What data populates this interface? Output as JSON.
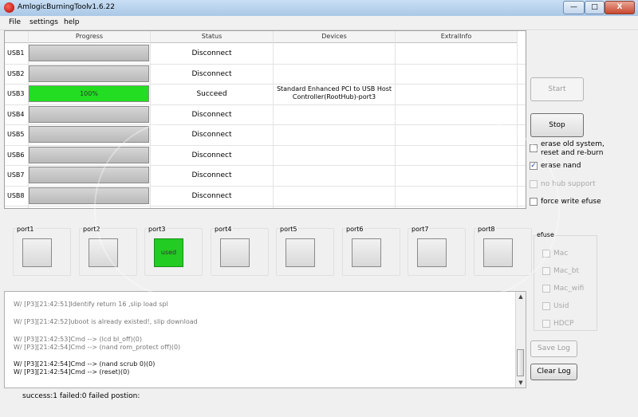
{
  "window": {
    "title": "AmlogicBurningTool",
    "version": "v1.6.22",
    "buttons": {
      "minimize": "—",
      "maximize": "□",
      "close": "X"
    }
  },
  "menu": [
    "File",
    "settings",
    "help"
  ],
  "grid": {
    "headers": [
      "Progress",
      "Status",
      "Devices",
      "ExtralInfo"
    ],
    "rows": [
      {
        "label": "USB1",
        "progress": "",
        "progress_value": 0,
        "status": "Disconnect",
        "device": "",
        "extra": ""
      },
      {
        "label": "USB2",
        "progress": "",
        "progress_value": 0,
        "status": "Disconnect",
        "device": "",
        "extra": ""
      },
      {
        "label": "USB3",
        "progress": "100%",
        "progress_value": 100,
        "status": "Succeed",
        "device": "Standard Enhanced PCI to USB Host Controller(RootHub)-port3",
        "extra": ""
      },
      {
        "label": "USB4",
        "progress": "",
        "progress_value": 0,
        "status": "Disconnect",
        "device": "",
        "extra": ""
      },
      {
        "label": "USB5",
        "progress": "",
        "progress_value": 0,
        "status": "Disconnect",
        "device": "",
        "extra": ""
      },
      {
        "label": "USB6",
        "progress": "",
        "progress_value": 0,
        "status": "Disconnect",
        "device": "",
        "extra": ""
      },
      {
        "label": "USB7",
        "progress": "",
        "progress_value": 0,
        "status": "Disconnect",
        "device": "",
        "extra": ""
      },
      {
        "label": "USB8",
        "progress": "",
        "progress_value": 0,
        "status": "Disconnect",
        "device": "",
        "extra": ""
      }
    ]
  },
  "controls": {
    "start": "Start",
    "stop": "Stop",
    "erase_old_system": "erase old system, reset and re-burn",
    "erase_nand": "erase nand",
    "no_hub_support": "no hub support",
    "force_write_efuse": "force write efuse",
    "erase_nand_checked": "✓"
  },
  "ports": [
    {
      "label": "port1",
      "text": ""
    },
    {
      "label": "port2",
      "text": ""
    },
    {
      "label": "port3",
      "text": "used"
    },
    {
      "label": "port4",
      "text": ""
    },
    {
      "label": "port5",
      "text": ""
    },
    {
      "label": "port6",
      "text": ""
    },
    {
      "label": "port7",
      "text": ""
    },
    {
      "label": "port8",
      "text": ""
    }
  ],
  "efuse": {
    "title": "efuse",
    "options": [
      "Mac",
      "Mac_bt",
      "Mac_wifi",
      "Usid",
      "HDCP"
    ]
  },
  "log": {
    "lines": [
      "W/ [P3][21:42:51]Identify return 16 ,slip load spl",
      "W/ [P3][21:42:52]uboot is already existed!, slip download",
      "W/ [P3][21:42:53]Cmd --> (lcd bl_off)(0)",
      "W/ [P3][21:42:54]Cmd --> (nand rom_protect off)(0)",
      "W/ [P3][21:42:54]Cmd --> (nand scrub 0)(0)",
      "W/ [P3][21:42:54]Cmd --> (reset)(0)"
    ],
    "save_log": "Save Log",
    "clear_log": "Clear Log",
    "scroll_up": "▲",
    "scroll_down": "▼"
  },
  "status_line": "success:1 failed:0 failed postion:",
  "colors": {
    "progress_success": "#22dd22",
    "port_used": "#22cc22"
  }
}
